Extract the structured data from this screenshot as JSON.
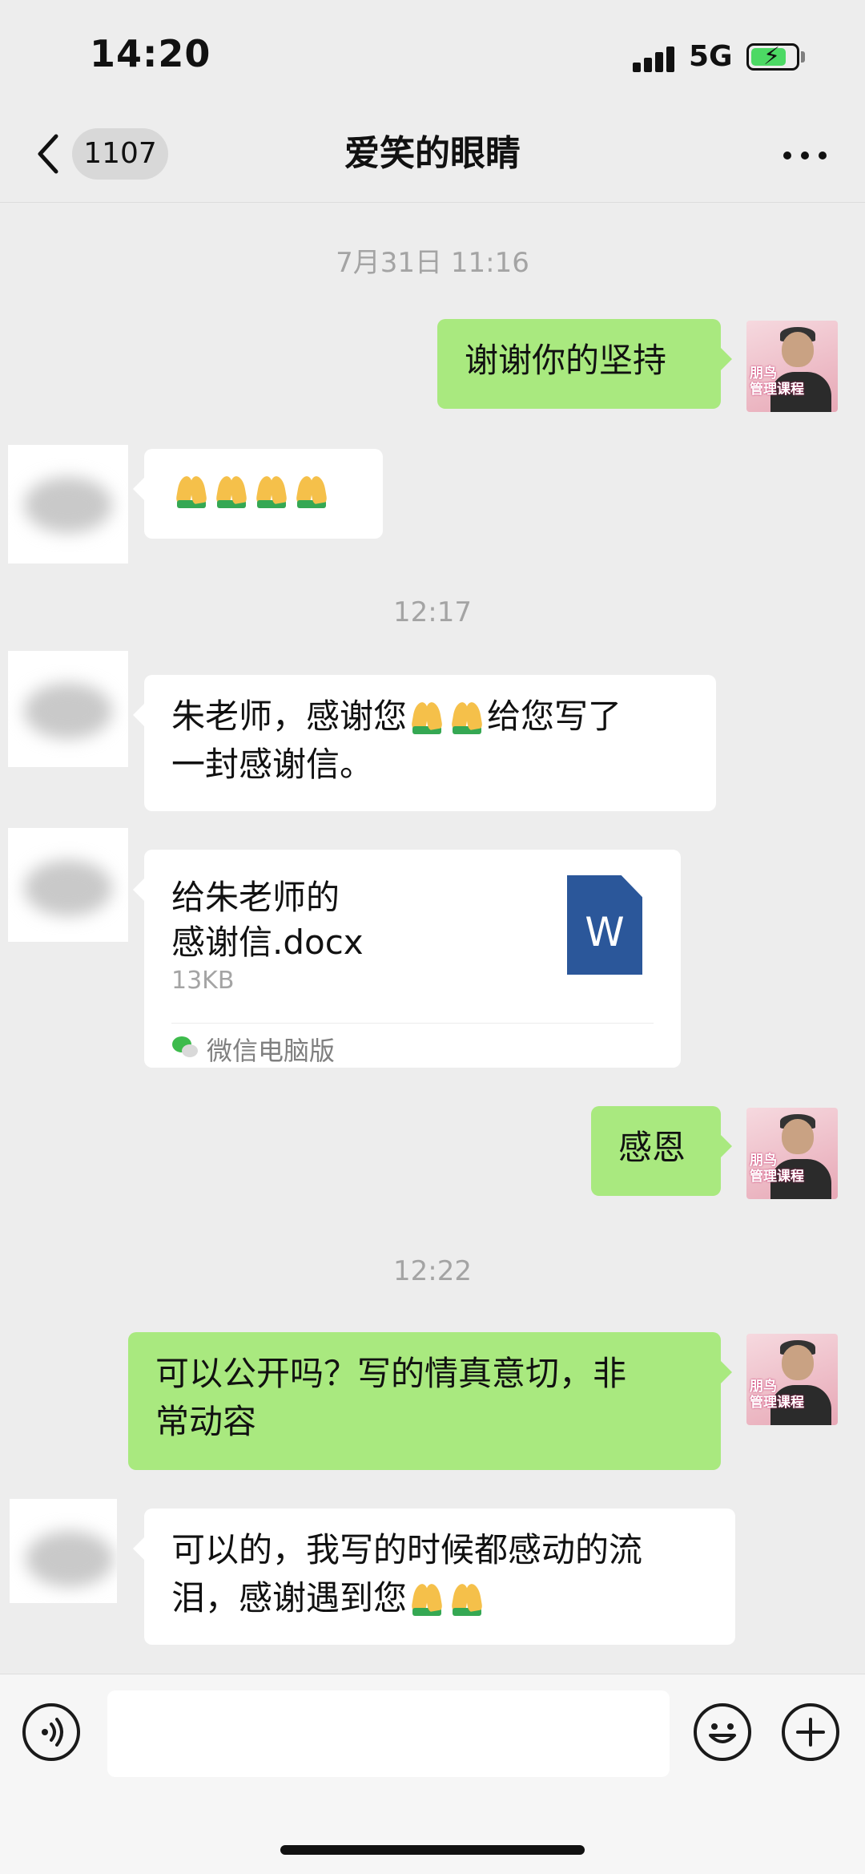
{
  "status_bar": {
    "time": "14:20",
    "network": "5G"
  },
  "nav": {
    "unread_count": "1107",
    "title": "爱笑的眼睛"
  },
  "messages": [
    {
      "timestamp": "7月31日 11:16"
    },
    {
      "sender": "me",
      "text": "谢谢你的坚持"
    },
    {
      "sender": "other",
      "emoji": "🙏🙏🙏🙏"
    },
    {
      "timestamp": "12:17"
    },
    {
      "sender": "other",
      "text_line1": "朱老师，感谢您",
      "text_line1_end": "给您写了",
      "text_line2": "一封感谢信。"
    },
    {
      "sender": "other",
      "file": {
        "name_line1": "给朱老师的",
        "name_line2": "感谢信.docx",
        "size": "13KB",
        "source": "微信电脑版",
        "icon_letter": "W"
      }
    },
    {
      "sender": "me",
      "text": "感恩"
    },
    {
      "timestamp": "12:22"
    },
    {
      "sender": "me",
      "text_line1": "可以公开吗？写的情真意切，非",
      "text_line2": "常动容"
    },
    {
      "sender": "other",
      "text_line1": "可以的，我写的时候都感动的流",
      "text_line2": "泪，感谢遇到您"
    }
  ],
  "my_avatar": {
    "caption_line1": "朋鸟",
    "caption_line2": "管理课程"
  },
  "icons": {
    "back": "chevron-left-icon",
    "more": "more-dots-icon",
    "voice": "voice-icon",
    "emoji": "emoji-icon",
    "plus": "plus-icon",
    "pray": "folded-hands-emoji"
  },
  "colors": {
    "my_bubble": "#a9e97f",
    "background": "#ededed",
    "doc_icon": "#2b579a"
  }
}
